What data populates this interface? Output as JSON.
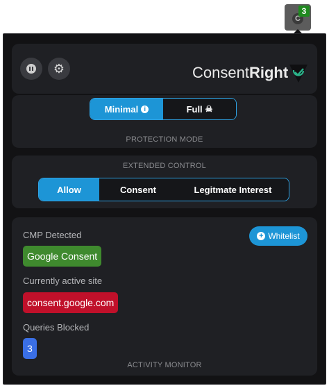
{
  "extension_button": {
    "icon": "consentright-logo-icon",
    "badge_count": "3",
    "badge_color": "#1f8a1f"
  },
  "header": {
    "pause_icon": "pause-icon",
    "settings_icon": "gear-icon",
    "brand_part1": "Consent",
    "brand_part2": "Right",
    "brand_logo": "checkmark-shield-icon"
  },
  "protection_mode": {
    "options": [
      {
        "label": "Minimal",
        "icon": "info-icon",
        "active": true
      },
      {
        "label": "Full",
        "icon": "skull-crossbones-icon",
        "active": false
      }
    ],
    "caption": "PROTECTION MODE"
  },
  "extended_control": {
    "caption": "EXTENDED CONTROL",
    "options": [
      {
        "label": "Allow",
        "active": true
      },
      {
        "label": "Consent",
        "active": false
      },
      {
        "label": "Legitmate Interest",
        "active": false
      }
    ]
  },
  "activity_monitor": {
    "whitelist_label": "Whitelist",
    "whitelist_icon": "plus-circle-icon",
    "cmp_label": "CMP Detected",
    "cmp_value": "Google Consent",
    "cmp_color": "#3f8a2e",
    "site_label": "Currently active site",
    "site_value": "consent.google.com",
    "site_color": "#c0102a",
    "queries_label": "Queries Blocked",
    "queries_value": "3",
    "queries_color": "#3a6fe6",
    "caption": "ACTIVITY MONITOR"
  },
  "colors": {
    "accent": "#1d95d6",
    "panel": "#1f2024",
    "background": "#121214"
  }
}
